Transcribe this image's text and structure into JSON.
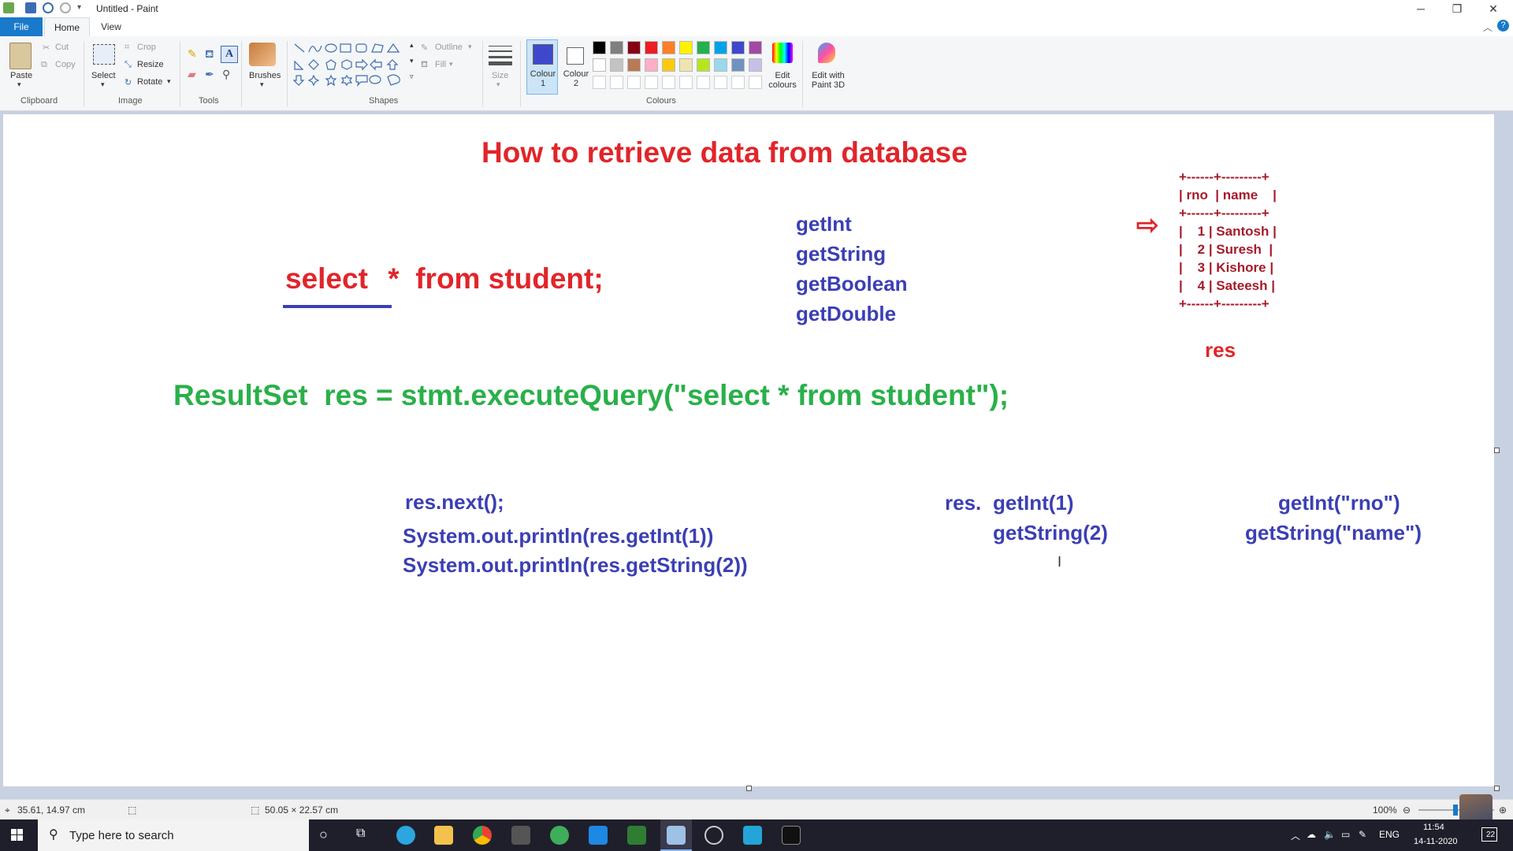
{
  "window": {
    "title": "Untitled - Paint",
    "minimize": "─",
    "restore": "❐",
    "close": "✕"
  },
  "tabs": {
    "file": "File",
    "home": "Home",
    "view": "View"
  },
  "ribbon": {
    "clipboard": {
      "paste": "Paste",
      "cut": "Cut",
      "copy": "Copy",
      "label": "Clipboard"
    },
    "image": {
      "select": "Select",
      "crop": "Crop",
      "resize": "Resize",
      "rotate": "Rotate",
      "label": "Image"
    },
    "tools": {
      "label": "Tools"
    },
    "brushes": "Brushes",
    "shapes": {
      "outline": "Outline",
      "fill": "Fill",
      "label": "Shapes"
    },
    "size": "Size",
    "colour1": "Colour 1",
    "colour2": "Colour 2",
    "colours_label": "Colours",
    "edit_colours": "Edit colours",
    "paint3d": "Edit with Paint 3D",
    "palette_row1": [
      "#000000",
      "#7f7f7f",
      "#880015",
      "#ed1c24",
      "#ff7f27",
      "#fff200",
      "#22b14c",
      "#00a2e8",
      "#3f48cc",
      "#a349a4"
    ],
    "palette_row2": [
      "#ffffff",
      "#c3c3c3",
      "#b97a57",
      "#ffaec9",
      "#ffc90e",
      "#efe4b0",
      "#b5e61d",
      "#99d9ea",
      "#7092be",
      "#c8bfe7"
    ],
    "colour1_value": "#3f48cc",
    "colour2_value": "#ffffff"
  },
  "canvas": {
    "heading": "How to retrieve data from database",
    "select_word": "select",
    "query_rest": " *  from student;",
    "getters": [
      "getInt",
      "getString",
      "getBoolean",
      "getDouble"
    ],
    "table_lines": [
      "+------+---------+",
      "| rno  | name    |",
      "+------+---------+",
      "|    1 | Santosh |",
      "|    2 | Suresh  |",
      "|    3 | Kishore |",
      "|    4 | Sateesh |",
      "+------+---------+"
    ],
    "arrow": "⇨",
    "res_label": "res",
    "resultset_line": "ResultSet  res = stmt.executeQuery(\"select * from student\");",
    "code_lines": [
      "res.next();",
      "System.out.println(res.getInt(1))",
      "System.out.println(res.getString(2))"
    ],
    "res_prefix": "res.",
    "by_index": [
      "getInt(1)",
      "getString(2)"
    ],
    "by_name": [
      "getInt(\"rno\")",
      "getString(\"name\")"
    ]
  },
  "status": {
    "cursor_pos": "35.61, 14.97 cm",
    "canvas_size": "50.05 × 22.57 cm",
    "zoom": "100%"
  },
  "taskbar": {
    "search_placeholder": "Type here to search",
    "lang": "ENG",
    "time": "11:54",
    "date": "14-11-2020",
    "notifications": "22"
  }
}
